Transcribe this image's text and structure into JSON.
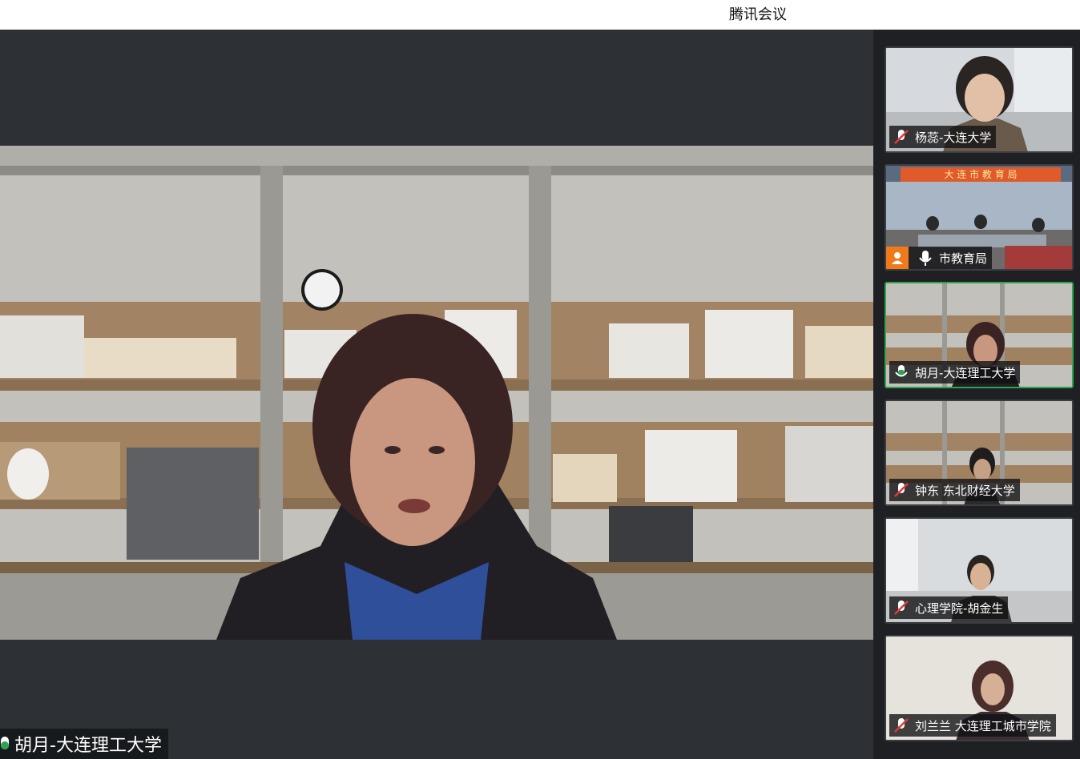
{
  "app": {
    "title": "腾讯会议"
  },
  "main": {
    "speaker_name": "胡月-大连理工大学",
    "speaker_mic": "mic-on-icon"
  },
  "participants": [
    {
      "name": "杨蕊-大连大学",
      "mic": "mic-muted-icon"
    },
    {
      "name": "市教育局",
      "mic": "mic-on-icon",
      "badge": "person-icon",
      "banner_text": "大 连 市 教 育 局"
    },
    {
      "name": "胡月-大连理工大学",
      "mic": "mic-on-icon",
      "active": true
    },
    {
      "name": "钟东 东北财经大学",
      "mic": "mic-muted-icon"
    },
    {
      "name": "心理学院-胡金生",
      "mic": "mic-muted-icon"
    },
    {
      "name": "刘兰兰 大连理工城市学院",
      "mic": "mic-muted-icon"
    }
  ],
  "colors": {
    "active_speaker_border": "#2ea44f",
    "mic_muted": "#e03a3a",
    "badge_orange": "#f07a1a"
  }
}
